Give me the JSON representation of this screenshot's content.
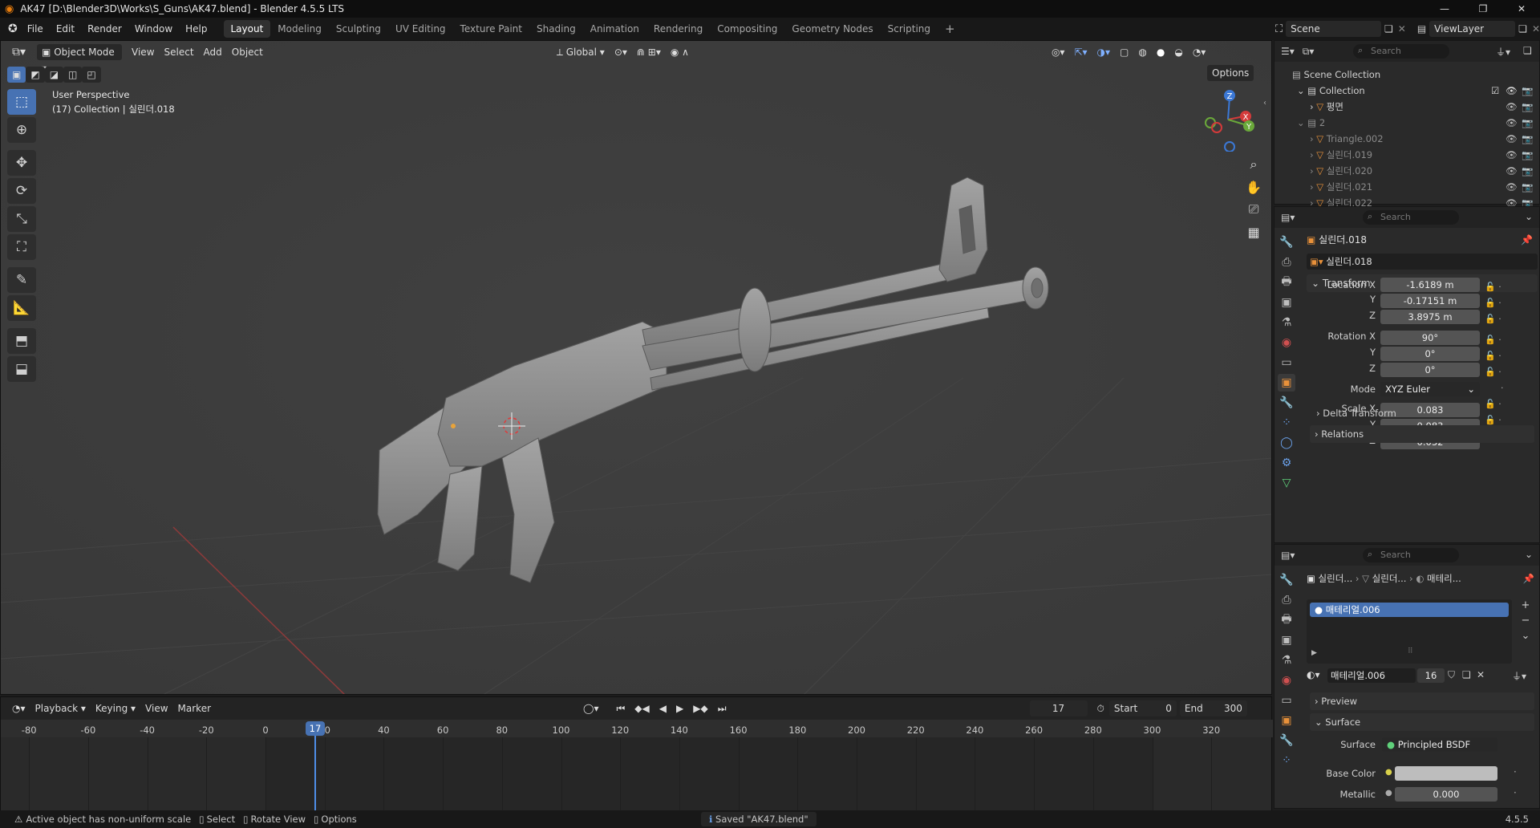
{
  "window": {
    "title": "AK47 [D:\\Blender3D\\Works\\S_Guns\\AK47.blend] - Blender 4.5.5 LTS",
    "controls": [
      "—",
      "❐",
      "✕"
    ]
  },
  "menu": [
    "File",
    "Edit",
    "Render",
    "Window",
    "Help"
  ],
  "workspaces": [
    "Layout",
    "Modeling",
    "Sculpting",
    "UV Editing",
    "Texture Paint",
    "Shading",
    "Animation",
    "Rendering",
    "Compositing",
    "Geometry Nodes",
    "Scripting"
  ],
  "active_workspace": "Layout",
  "scene": {
    "name": "Scene",
    "view_layer": "ViewLayer"
  },
  "viewport_header": {
    "mode": "Object Mode",
    "menus": [
      "View",
      "Select",
      "Add",
      "Object"
    ],
    "orientation": "Global",
    "options": "Options"
  },
  "viewport_overlay": {
    "perspective": "User Perspective",
    "collection_info": "(17) Collection | 실린더.018"
  },
  "gizmo": {
    "z": "Z",
    "x": "X",
    "y": "Y"
  },
  "outliner": {
    "search_placeholder": "Search",
    "root": "Scene Collection",
    "collection": "Collection",
    "items": [
      {
        "name": "평면",
        "indent": 1,
        "dim": false
      },
      {
        "name": "2",
        "indent": 0,
        "dim": true
      },
      {
        "name": "Triangle.002",
        "indent": 1,
        "dim": true
      },
      {
        "name": "실린더.019",
        "indent": 1,
        "dim": true
      },
      {
        "name": "실린더.020",
        "indent": 1,
        "dim": true
      },
      {
        "name": "실린더.021",
        "indent": 1,
        "dim": true
      },
      {
        "name": "실린더.022",
        "indent": 1,
        "dim": true
      }
    ]
  },
  "properties": {
    "search_placeholder": "Search",
    "object_name": "실린더.018",
    "object_field": "실린더.018",
    "transform_label": "Transform",
    "location": {
      "label": "Location X",
      "x": "-1.6189 m",
      "y": "-0.17151 m",
      "z": "3.8975 m"
    },
    "rotation": {
      "label": "Rotation X",
      "x": "90°",
      "y": "0°",
      "z": "0°"
    },
    "mode_label": "Mode",
    "mode_value": "XYZ Euler",
    "scale": {
      "label": "Scale X",
      "x": "0.083",
      "y": "0.083",
      "z": "0.032"
    },
    "axis_y": "Y",
    "axis_z": "Z",
    "delta": "Delta Transform",
    "relations": "Relations"
  },
  "material": {
    "search_placeholder": "Search",
    "breadcrumb": [
      "실린더...",
      "실린더...",
      "매테리..."
    ],
    "slot": "매테리얼.006",
    "name": "매테리얼.006",
    "users": "16",
    "preview": "Preview",
    "surface_section": "Surface",
    "surface_label": "Surface",
    "surface_value": "Principled BSDF",
    "base_color_label": "Base Color",
    "metallic_label": "Metallic",
    "metallic_value": "0.000"
  },
  "timeline": {
    "menus": [
      "Playback",
      "Keying",
      "View",
      "Marker"
    ],
    "current_frame": "17",
    "start_label": "Start",
    "start": "0",
    "end_label": "End",
    "end": "300",
    "ticks": [
      "-80",
      "-60",
      "-40",
      "-20",
      "0",
      "20",
      "40",
      "60",
      "80",
      "100",
      "120",
      "140",
      "160",
      "180",
      "200",
      "220",
      "240",
      "260",
      "280",
      "300",
      "320"
    ]
  },
  "status": {
    "warning": "Active object has non-uniform scale",
    "select": "Select",
    "rotate": "Rotate View",
    "options": "Options",
    "saved": "Saved \"AK47.blend\"",
    "version": "4.5.5"
  }
}
